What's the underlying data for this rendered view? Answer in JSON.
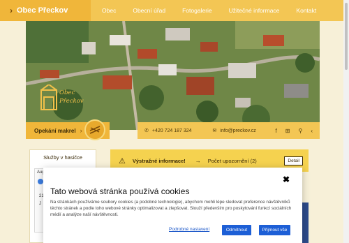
{
  "header": {
    "brand": "Obec Přeckov",
    "nav": [
      "Obec",
      "Obecní úřad",
      "Fotogalerie",
      "Užitečné informace",
      "Kontakt"
    ]
  },
  "hero": {
    "logo_text": "Obec Přeckov"
  },
  "quick": {
    "opekani": "Opekání makrel",
    "phone": "+420 724 187 324",
    "email": "info@preckov.cz"
  },
  "sidebar": {
    "title": "Služby v hasičce",
    "calendar": {
      "month": "Aug",
      "day1": "21 A",
      "day2": "J"
    }
  },
  "alert": {
    "label": "Výstražné informace!",
    "count": "Počet upozornění (2)",
    "detail": "Detail"
  },
  "cookies": {
    "title": "Tato webová stránka používá cookies",
    "text": "Na stránkách používáme soubory cookies (a podobné technologie), abychom mohli lépe sledovat preference návštěvníků těchto stránek a podle toho webové stránky optimalizovat a zlepšovat. Slouží především pro poskytování funkcí sociálních médií a analýze naší návštěvnosti.",
    "settings": "Podrobné nastavení",
    "reject": "Odmítnout",
    "accept": "Přijmout vše"
  },
  "colors": {
    "accent": "#f3c654",
    "accent_dark": "#f0b63a",
    "button": "#1d5fd6"
  }
}
